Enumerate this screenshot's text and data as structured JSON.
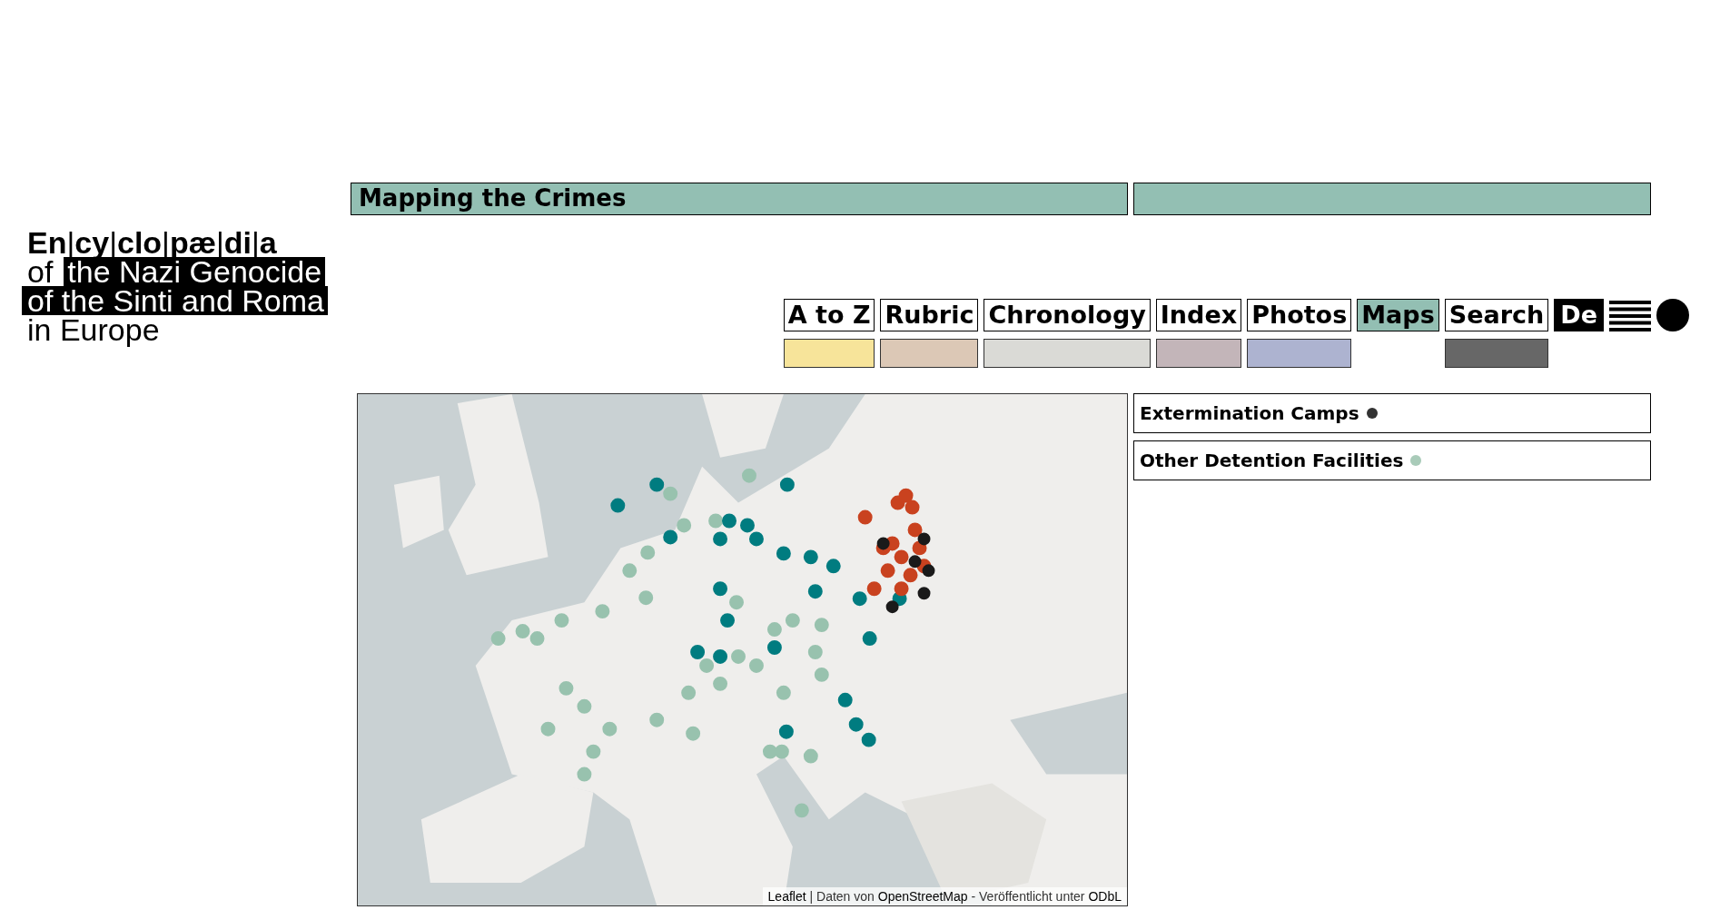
{
  "page_title": "Mapping the Crimes",
  "logo": {
    "title": "**En**|**cy**|**clo**|**pæ**|**di**|**a**",
    "lines": [
      [
        {
          "text": "of",
          "highlighted": false
        },
        {
          "text": "the Nazi Genocide",
          "highlighted": true
        }
      ],
      [
        {
          "text": "of the Sinti and Roma",
          "highlighted": true
        }
      ],
      [
        {
          "text": "in Europe",
          "highlighted": false
        }
      ]
    ]
  },
  "nav": [
    {
      "label": "A to Z",
      "selected": false,
      "color": "#f7e49a"
    },
    {
      "label": "Rubric",
      "selected": false,
      "color": "#dcc8b6"
    },
    {
      "label": "Chronology",
      "selected": false,
      "color": "#dadad6"
    },
    {
      "label": "Index",
      "selected": false,
      "color": "#c3b5b9"
    },
    {
      "label": "Photos",
      "selected": false,
      "color": "#adb3d0"
    },
    {
      "label": "Maps",
      "selected": true
    },
    {
      "label": "Search",
      "selected": false,
      "color": "#676767"
    }
  ],
  "language": "De",
  "map": {
    "kind": "picture",
    "attribution": [
      {
        "text": "Leaflet",
        "kind": "link"
      },
      {
        "text": " | Daten von ",
        "kind": "text"
      },
      {
        "text": "OpenStreetMap",
        "kind": "link"
      },
      {
        "text": " - Veröffentlicht unter ",
        "kind": "text"
      },
      {
        "text": "ODbL",
        "kind": "link"
      }
    ]
  },
  "legend": [
    {
      "label": "Extermination Camps",
      "color": "#333333"
    },
    {
      "label": "Other Detention Facilities",
      "color": "#a9cbb9"
    }
  ]
}
